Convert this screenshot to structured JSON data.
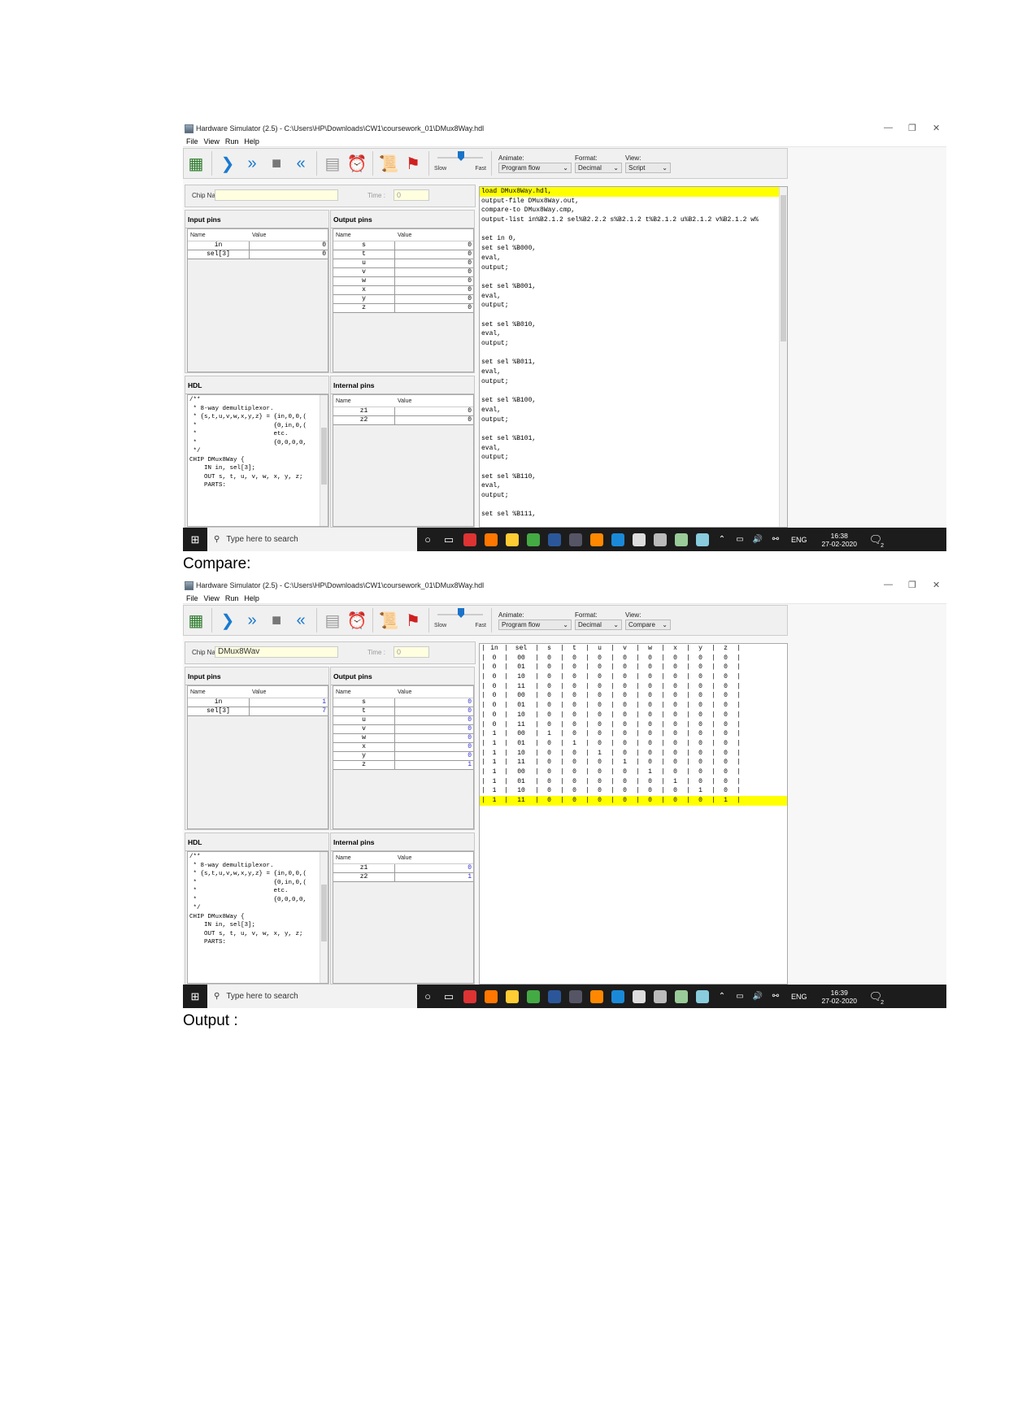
{
  "page": {
    "compare_label": "Compare:",
    "output_label": "Output :"
  },
  "windows": [
    {
      "title": "Hardware Simulator (2.5) - C:\\Users\\HP\\Downloads\\CW1\\coursework_01\\DMux8Way.hdl",
      "menu": [
        "File",
        "View",
        "Run",
        "Help"
      ],
      "toolbar": {
        "icons": [
          "chip-icon",
          "single-step-icon",
          "fast-forward-icon",
          "stop-icon",
          "rewind-icon",
          "calculator-icon",
          "clock-icon",
          "script-icon",
          "breakpoint-flag-icon"
        ],
        "slow_label": "Slow",
        "fast_label": "Fast",
        "speed": 0.5,
        "animate_label": "Animate:",
        "animate_value": "Program flow",
        "format_label": "Format:",
        "format_value": "Decimal",
        "view_label": "View:",
        "view_value": "Script"
      },
      "chip_name_label": "Chip Name :",
      "chip_name": "",
      "time_label": "Time :",
      "time": "0",
      "value_color": "#000000",
      "input_pins": {
        "title": "Input pins",
        "headers": [
          "Name",
          "Value"
        ],
        "rows": [
          {
            "name": "in",
            "value": "0"
          },
          {
            "name": "sel[3]",
            "value": "0"
          }
        ]
      },
      "output_pins": {
        "title": "Output pins",
        "headers": [
          "Name",
          "Value"
        ],
        "rows": [
          {
            "name": "s",
            "value": "0"
          },
          {
            "name": "t",
            "value": "0"
          },
          {
            "name": "u",
            "value": "0"
          },
          {
            "name": "v",
            "value": "0"
          },
          {
            "name": "w",
            "value": "0"
          },
          {
            "name": "x",
            "value": "0"
          },
          {
            "name": "y",
            "value": "0"
          },
          {
            "name": "z",
            "value": "0"
          }
        ]
      },
      "hdl": {
        "title": "HDL",
        "lines": [
          "/**",
          " * 8-way demultiplexor.",
          " * {s,t,u,v,w,x,y,z} = {in,0,0,(",
          " *                     {0,in,0,(",
          " *                     etc.",
          " *                     {0,0,0,0,",
          " */",
          "",
          "",
          "CHIP DMux8Way {",
          "    IN in, sel[3];",
          "    OUT s, t, u, v, w, x, y, z;",
          "",
          "    PARTS:"
        ]
      },
      "internal_pins": {
        "title": "Internal pins",
        "headers": [
          "Name",
          "Value"
        ],
        "rows": [
          {
            "name": "z1",
            "value": "0"
          },
          {
            "name": "z2",
            "value": "0"
          }
        ]
      },
      "script_lines": [
        "load DMux8Way.hdl,",
        "output-file DMux8Way.out,",
        "compare-to DMux8Way.cmp,",
        "output-list in%B2.1.2 sel%B2.2.2 s%B2.1.2 t%B2.1.2 u%B2.1.2 v%B2.1.2 w%",
        "",
        "set in 0,",
        "set sel %B000,",
        "eval,",
        "output;",
        "",
        "set sel %B001,",
        "eval,",
        "output;",
        "",
        "set sel %B010,",
        "eval,",
        "output;",
        "",
        "set sel %B011,",
        "eval,",
        "output;",
        "",
        "set sel %B100,",
        "eval,",
        "output;",
        "",
        "set sel %B101,",
        "eval,",
        "output;",
        "",
        "set sel %B110,",
        "eval,",
        "output;",
        "",
        "set sel %B111,"
      ],
      "highlight_line": 0,
      "taskbar": {
        "search_placeholder": "Type here to search",
        "language": "ENG",
        "time": "16:38",
        "date": "27-02-2020",
        "notifications": "2"
      }
    },
    {
      "title": "Hardware Simulator (2.5) - C:\\Users\\HP\\Downloads\\CW1\\coursework_01\\DMux8Way.hdl",
      "menu": [
        "File",
        "View",
        "Run",
        "Help"
      ],
      "toolbar": {
        "icons": [
          "chip-icon",
          "single-step-icon",
          "fast-forward-icon",
          "stop-icon",
          "rewind-icon",
          "calculator-icon",
          "clock-icon",
          "script-icon",
          "breakpoint-flag-icon"
        ],
        "slow_label": "Slow",
        "fast_label": "Fast",
        "speed": 0.5,
        "animate_label": "Animate:",
        "animate_value": "Program flow",
        "format_label": "Format:",
        "format_value": "Decimal",
        "view_label": "View:",
        "view_value": "Compare"
      },
      "chip_name_label": "Chip Name :",
      "chip_name": "DMux8Wav",
      "time_label": "Time :",
      "time": "0",
      "value_color": "#2b2bd0",
      "input_pins": {
        "title": "Input pins",
        "headers": [
          "Name",
          "Value"
        ],
        "rows": [
          {
            "name": "in",
            "value": "1"
          },
          {
            "name": "sel[3]",
            "value": "7"
          }
        ]
      },
      "output_pins": {
        "title": "Output pins",
        "headers": [
          "Name",
          "Value"
        ],
        "rows": [
          {
            "name": "s",
            "value": "0"
          },
          {
            "name": "t",
            "value": "0"
          },
          {
            "name": "u",
            "value": "0"
          },
          {
            "name": "v",
            "value": "0"
          },
          {
            "name": "w",
            "value": "0"
          },
          {
            "name": "x",
            "value": "0"
          },
          {
            "name": "y",
            "value": "0"
          },
          {
            "name": "z",
            "value": "1"
          }
        ]
      },
      "hdl": {
        "title": "HDL",
        "lines": [
          "/**",
          " * 8-way demultiplexor.",
          " * {s,t,u,v,w,x,y,z} = {in,0,0,(",
          " *                     {0,in,0,(",
          " *                     etc.",
          " *                     {0,0,0,0,",
          " */",
          "",
          "",
          "CHIP DMux8Way {",
          "    IN in, sel[3];",
          "    OUT s, t, u, v, w, x, y, z;",
          "",
          "    PARTS:"
        ]
      },
      "internal_pins": {
        "title": "Internal pins",
        "headers": [
          "Name",
          "Value"
        ],
        "rows": [
          {
            "name": "z1",
            "value": "0"
          },
          {
            "name": "z2",
            "value": "1"
          }
        ]
      },
      "compare_table": {
        "headers": [
          "in",
          "sel",
          "s",
          "t",
          "u",
          "v",
          "w",
          "x",
          "y",
          "z"
        ],
        "rows": [
          [
            "0",
            "00",
            "0",
            "0",
            "0",
            "0",
            "0",
            "0",
            "0",
            "0"
          ],
          [
            "0",
            "01",
            "0",
            "0",
            "0",
            "0",
            "0",
            "0",
            "0",
            "0"
          ],
          [
            "0",
            "10",
            "0",
            "0",
            "0",
            "0",
            "0",
            "0",
            "0",
            "0"
          ],
          [
            "0",
            "11",
            "0",
            "0",
            "0",
            "0",
            "0",
            "0",
            "0",
            "0"
          ],
          [
            "0",
            "00",
            "0",
            "0",
            "0",
            "0",
            "0",
            "0",
            "0",
            "0"
          ],
          [
            "0",
            "01",
            "0",
            "0",
            "0",
            "0",
            "0",
            "0",
            "0",
            "0"
          ],
          [
            "0",
            "10",
            "0",
            "0",
            "0",
            "0",
            "0",
            "0",
            "0",
            "0"
          ],
          [
            "0",
            "11",
            "0",
            "0",
            "0",
            "0",
            "0",
            "0",
            "0",
            "0"
          ],
          [
            "1",
            "00",
            "1",
            "0",
            "0",
            "0",
            "0",
            "0",
            "0",
            "0"
          ],
          [
            "1",
            "01",
            "0",
            "1",
            "0",
            "0",
            "0",
            "0",
            "0",
            "0"
          ],
          [
            "1",
            "10",
            "0",
            "0",
            "1",
            "0",
            "0",
            "0",
            "0",
            "0"
          ],
          [
            "1",
            "11",
            "0",
            "0",
            "0",
            "1",
            "0",
            "0",
            "0",
            "0"
          ],
          [
            "1",
            "00",
            "0",
            "0",
            "0",
            "0",
            "1",
            "0",
            "0",
            "0"
          ],
          [
            "1",
            "01",
            "0",
            "0",
            "0",
            "0",
            "0",
            "1",
            "0",
            "0"
          ],
          [
            "1",
            "10",
            "0",
            "0",
            "0",
            "0",
            "0",
            "0",
            "1",
            "0"
          ],
          [
            "1",
            "11",
            "0",
            "0",
            "0",
            "0",
            "0",
            "0",
            "0",
            "1"
          ]
        ],
        "highlight_row": 15
      },
      "taskbar": {
        "search_placeholder": "Type here to search",
        "language": "ENG",
        "time": "16:39",
        "date": "27-02-2020",
        "notifications": "2"
      }
    }
  ],
  "colors": {
    "highlight": "#ffff00",
    "taskbar": "#1c1c1c",
    "chip_field": "#ffffe0"
  }
}
